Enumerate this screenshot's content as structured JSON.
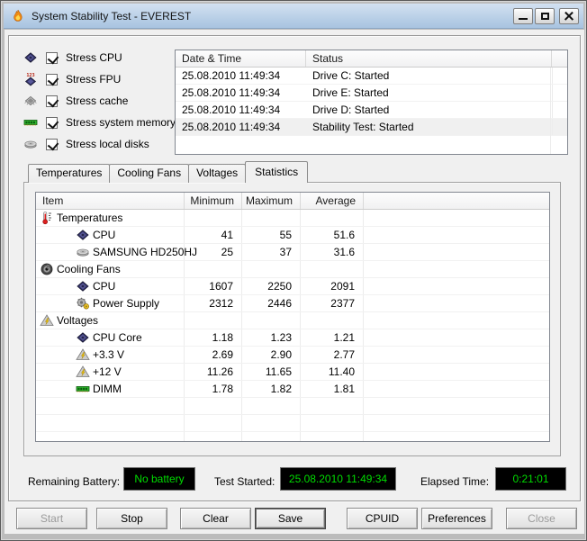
{
  "window": {
    "title": "System Stability Test - EVEREST"
  },
  "colors": {
    "titlebar": "#b4cce5",
    "display_bg": "#000000",
    "display_text": "#00dc00",
    "memory_green": "#2db52d",
    "voltage_yellow": "#f5c800"
  },
  "stress_options": [
    {
      "icon": "cpu-icon",
      "label": "Stress CPU",
      "checked": true
    },
    {
      "icon": "fpu-icon",
      "label": "Stress FPU",
      "checked": true
    },
    {
      "icon": "cache-icon",
      "label": "Stress cache",
      "checked": true
    },
    {
      "icon": "memory-icon",
      "label": "Stress system memory",
      "checked": true
    },
    {
      "icon": "disk-icon",
      "label": "Stress local disks",
      "checked": true
    }
  ],
  "log": {
    "columns": [
      "Date & Time",
      "Status"
    ],
    "rows": [
      {
        "datetime": "25.08.2010 11:49:34",
        "status": "Drive C: Started",
        "highlighted": false
      },
      {
        "datetime": "25.08.2010 11:49:34",
        "status": "Drive E: Started",
        "highlighted": false
      },
      {
        "datetime": "25.08.2010 11:49:34",
        "status": "Drive D: Started",
        "highlighted": false
      },
      {
        "datetime": "25.08.2010 11:49:34",
        "status": "Stability Test: Started",
        "highlighted": true
      }
    ]
  },
  "tabs": [
    {
      "label": "Temperatures",
      "active": false
    },
    {
      "label": "Cooling Fans",
      "active": false
    },
    {
      "label": "Voltages",
      "active": false
    },
    {
      "label": "Statistics",
      "active": true
    }
  ],
  "stats": {
    "columns": [
      "Item",
      "Minimum",
      "Maximum",
      "Average"
    ],
    "rows": [
      {
        "type": "group",
        "icon": "thermometer-icon",
        "item": "Temperatures",
        "min": "",
        "max": "",
        "avg": ""
      },
      {
        "type": "child",
        "icon": "cpu-icon",
        "item": "CPU",
        "min": "41",
        "max": "55",
        "avg": "51.6"
      },
      {
        "type": "child",
        "icon": "disk-icon",
        "item": "SAMSUNG HD250HJ",
        "min": "25",
        "max": "37",
        "avg": "31.6"
      },
      {
        "type": "group",
        "icon": "fan-icon",
        "item": "Cooling Fans",
        "min": "",
        "max": "",
        "avg": ""
      },
      {
        "type": "child",
        "icon": "cpu-icon",
        "item": "CPU",
        "min": "1607",
        "max": "2250",
        "avg": "2091"
      },
      {
        "type": "child",
        "icon": "psu-icon",
        "item": "Power Supply",
        "min": "2312",
        "max": "2446",
        "avg": "2377"
      },
      {
        "type": "group",
        "icon": "voltage-icon",
        "item": "Voltages",
        "min": "",
        "max": "",
        "avg": ""
      },
      {
        "type": "child",
        "icon": "cpu-icon",
        "item": "CPU Core",
        "min": "1.18",
        "max": "1.23",
        "avg": "1.21"
      },
      {
        "type": "child",
        "icon": "voltage-icon",
        "item": "+3.3 V",
        "min": "2.69",
        "max": "2.90",
        "avg": "2.77"
      },
      {
        "type": "child",
        "icon": "voltage-icon",
        "item": "+12 V",
        "min": "11.26",
        "max": "11.65",
        "avg": "11.40"
      },
      {
        "type": "child",
        "icon": "memory-icon",
        "item": "DIMM",
        "min": "1.78",
        "max": "1.82",
        "avg": "1.81"
      }
    ]
  },
  "status_bar": {
    "battery_label": "Remaining Battery:",
    "battery_value": "No battery",
    "test_started_label": "Test Started:",
    "test_started_value": "25.08.2010 11:49:34",
    "elapsed_label": "Elapsed Time:",
    "elapsed_value": "0:21:01"
  },
  "buttons": {
    "start": "Start",
    "stop": "Stop",
    "clear": "Clear",
    "save": "Save",
    "cpuid": "CPUID",
    "preferences": "Preferences",
    "close": "Close"
  }
}
